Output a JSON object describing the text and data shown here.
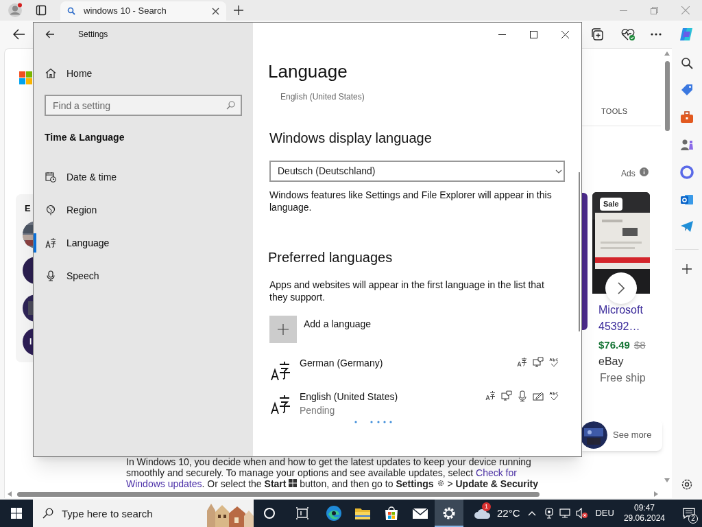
{
  "browser": {
    "tab": {
      "title": "windows 10 - Search"
    },
    "page": {
      "tools_label": "TOOLS",
      "left_heading": "E",
      "left_badge": "I",
      "ads_label": "Ads",
      "product": {
        "badge": "Sale",
        "title": "Microsoft",
        "model": "45392…",
        "price": "$76.49",
        "old_price": "$8",
        "seller": "eBay",
        "shipping": "Free ship"
      },
      "see_more": "See more",
      "article": [
        [
          {
            "kind": "text",
            "text": "In Windows 10, you decide when and how to get the latest updates to keep your device running"
          }
        ],
        [
          {
            "kind": "text",
            "text": "smoothly and securely. To manage your options and see available updates, select "
          },
          {
            "kind": "link",
            "text": "Check for"
          }
        ],
        [
          {
            "kind": "link",
            "text": "Windows updates"
          },
          {
            "kind": "text",
            "text": ". Or select the **Start** "
          },
          {
            "kind": "logo"
          },
          {
            "kind": "text",
            "text": " button, and then go to **Settings** "
          },
          {
            "kind": "gear"
          },
          {
            "kind": "text",
            "text": " > **Update & Security**"
          }
        ]
      ]
    }
  },
  "settings": {
    "title": "Settings",
    "home": "Home",
    "search": {
      "placeholder": "Find a setting"
    },
    "section": "Time & Language",
    "nav": [
      {
        "kind": "datetime",
        "label": "Date & time",
        "selected": false
      },
      {
        "kind": "region",
        "label": "Region",
        "selected": false
      },
      {
        "kind": "language",
        "label": "Language",
        "selected": true
      },
      {
        "kind": "speech",
        "label": "Speech",
        "selected": false
      }
    ],
    "page_title": "Language",
    "current_language": "English (United States)",
    "display_language": {
      "heading": "Windows display language",
      "value": "Deutsch (Deutschland)",
      "description": "Windows features like Settings and File Explorer will appear in this language."
    },
    "preferred": {
      "heading": "Preferred languages",
      "description": "Apps and websites will appear in the first language in the list that they support.",
      "add_label": "Add a language",
      "languages": [
        {
          "name": "German (Germany)",
          "features": [
            {
              "kind": "display"
            },
            {
              "kind": "tts"
            },
            {
              "kind": "spelling"
            }
          ]
        },
        {
          "name": "English (United States)",
          "status": "Pending",
          "features": [
            {
              "kind": "display"
            },
            {
              "kind": "tts"
            },
            {
              "kind": "speech"
            },
            {
              "kind": "handwriting"
            },
            {
              "kind": "spelling"
            }
          ]
        }
      ]
    }
  },
  "taskbar": {
    "search": {
      "placeholder": "Type here to search"
    },
    "apps": [
      {
        "kind": "cortana",
        "selected": false
      },
      {
        "kind": "task-view",
        "selected": false
      },
      {
        "kind": "edge",
        "selected": false
      },
      {
        "kind": "explorer",
        "selected": false
      },
      {
        "kind": "store",
        "selected": false
      },
      {
        "kind": "mail",
        "selected": false
      },
      {
        "kind": "settings",
        "selected": true
      }
    ],
    "weather": {
      "badge": "1",
      "temperature": "22°C"
    },
    "language": "DEU",
    "time": "09:47",
    "date": "29.06.2024",
    "notifications": "2"
  }
}
